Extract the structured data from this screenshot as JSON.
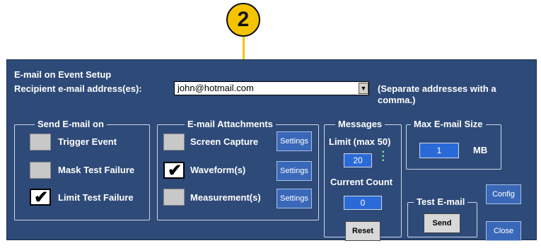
{
  "callout": {
    "number": "2"
  },
  "dialog": {
    "title": "E-mail on Event Setup",
    "recipient_label": "Recipient e-mail address(es):",
    "recipient_value": "john@hotmail.com",
    "hint": "(Separate addresses with a comma.)"
  },
  "send_email_on": {
    "legend": "Send E-mail on",
    "options": [
      {
        "label": "Trigger Event",
        "checked": false
      },
      {
        "label": "Mask Test Failure",
        "checked": false
      },
      {
        "label": "Limit Test Failure",
        "checked": true
      }
    ]
  },
  "attachments": {
    "legend": "E-mail Attachments",
    "settings_label": "Settings",
    "options": [
      {
        "label": "Screen Capture",
        "checked": false
      },
      {
        "label": "Waveform(s)",
        "checked": true
      },
      {
        "label": "Measurement(s)",
        "checked": false
      }
    ]
  },
  "messages": {
    "legend": "Messages",
    "limit_label": "Limit (max 50)",
    "limit_value": "20",
    "current_count_label": "Current Count",
    "current_count_value": "0",
    "reset_label": "Reset"
  },
  "max_size": {
    "legend": "Max E-mail Size",
    "value": "1",
    "unit": "MB"
  },
  "test_email": {
    "legend": "Test E-mail",
    "send_label": "Send"
  },
  "config_label": "Config",
  "close_label": "Close",
  "colors": {
    "dialog_bg": "#2e4a78",
    "callout": "#f5c400",
    "accent_button": "#3a68b8",
    "field_blue": "#2a6ad8"
  }
}
